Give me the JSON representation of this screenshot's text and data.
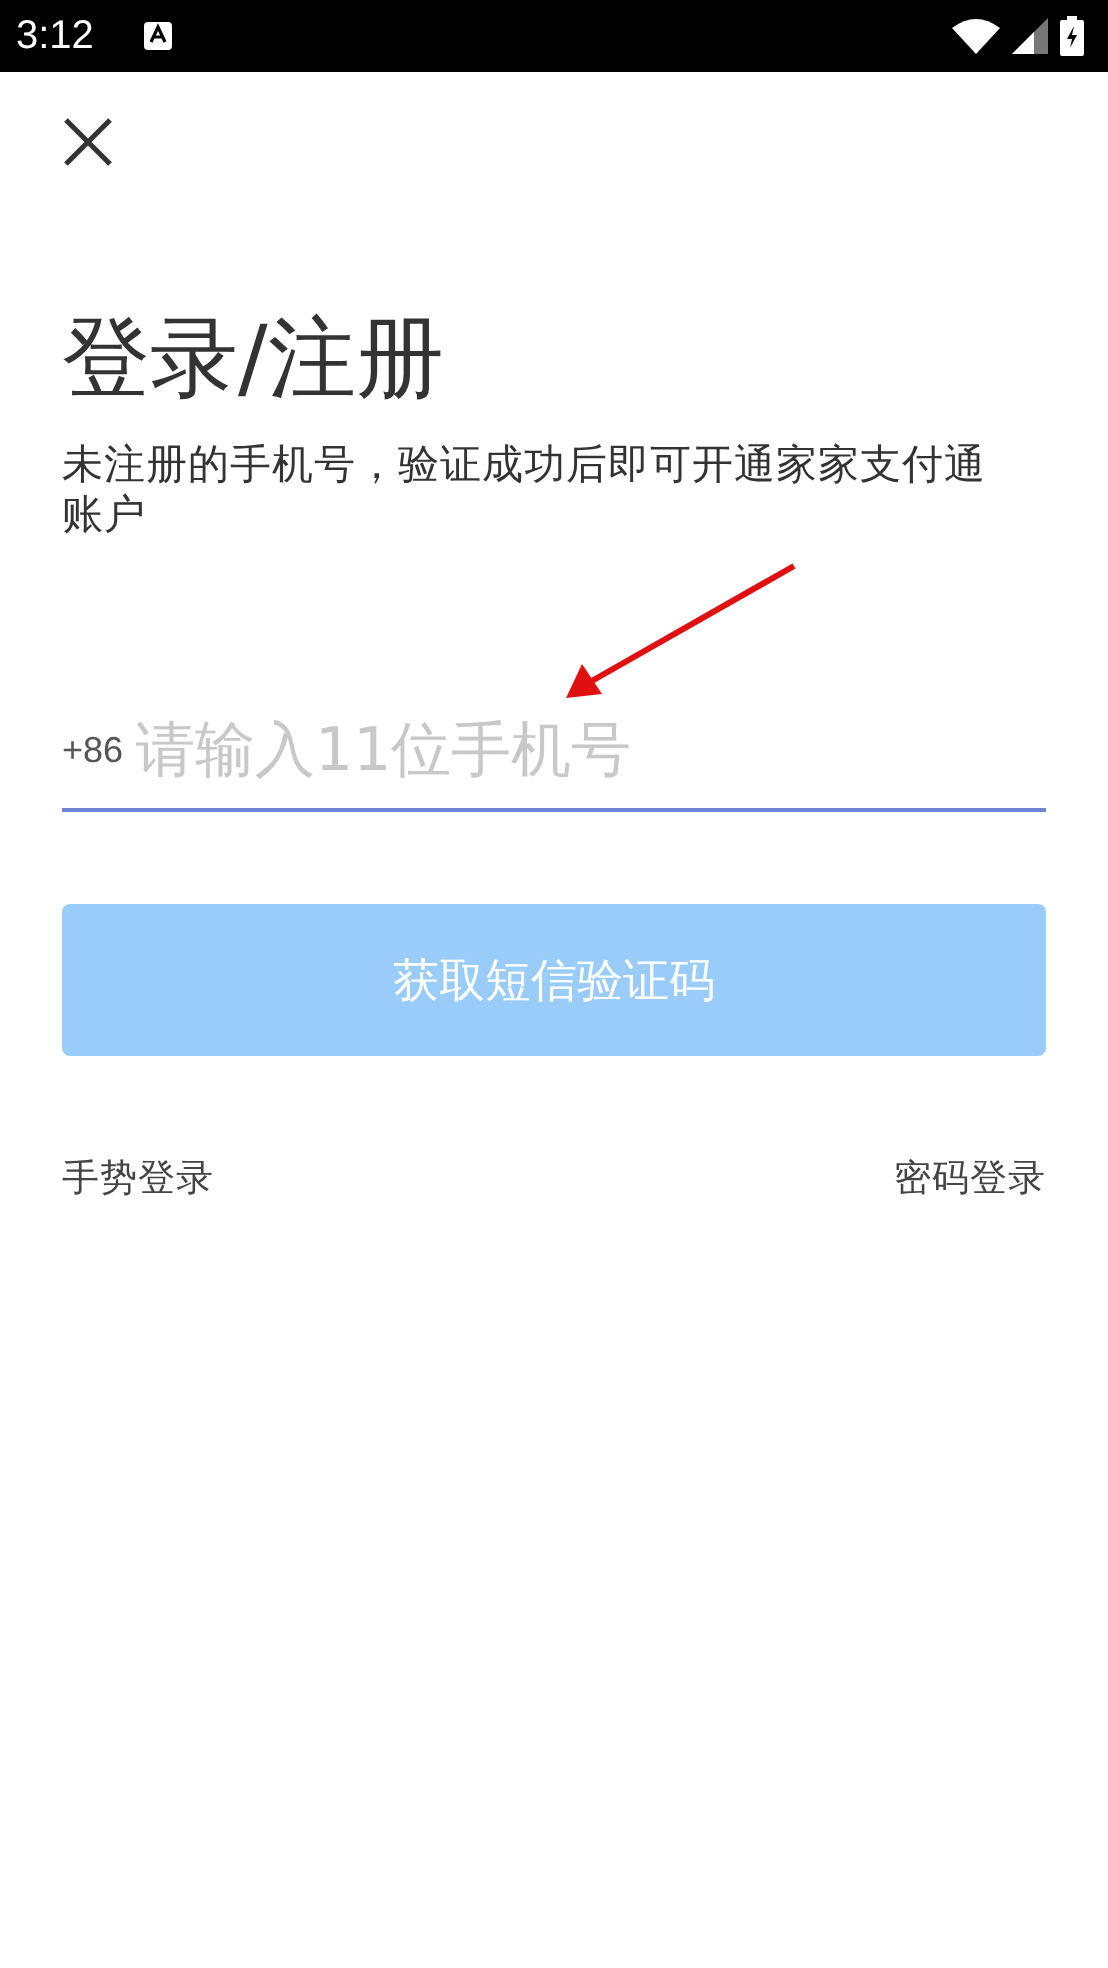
{
  "status_bar": {
    "time": "3:12"
  },
  "title": "登录/注册",
  "subtitle": "未注册的手机号，验证成功后即可开通家家支付通账户",
  "phone_field": {
    "prefix": "+86",
    "placeholder": "请输入11位手机号"
  },
  "submit_button": {
    "label": "获取短信验证码",
    "disabled": true
  },
  "links": [
    "手势登录",
    "密码登录"
  ]
}
